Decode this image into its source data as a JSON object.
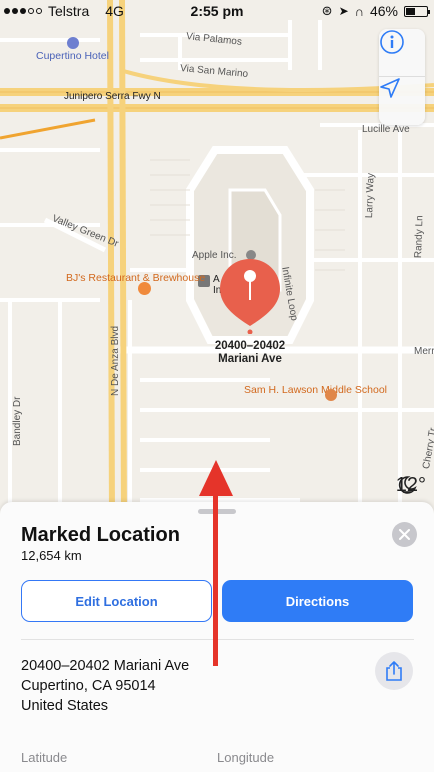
{
  "status_bar": {
    "carrier": "Telstra",
    "network": "4G",
    "time": "2:55 pm",
    "battery": "46%",
    "battery_level": 0.46
  },
  "map": {
    "labels": {
      "hotel": "Cupertino Hotel",
      "via_palamos": "Via Palamos",
      "via_san_marino": "Via San Marino",
      "junipero": "Junipero Serra Fwy N",
      "lucille": "Lucille Ave",
      "valley_green": "Valley Green Dr",
      "apple_inc": "Apple Inc.",
      "apple_inc_partial": "A",
      "apple_inc_partial2": "Inc",
      "restaurant": "BJ's Restaurant & Brewhouse",
      "infinite_loop": "Infinite Loop",
      "larry_way": "Larry Way",
      "randy_ln": "Randy Ln",
      "de_anza": "N De Anza Blvd",
      "merr": "Merr",
      "school": "Sam H. Lawson Middle School",
      "bandley": "Bandley Dr",
      "cherry": "Cherry Tr"
    },
    "pin_label_line1": "20400–20402",
    "pin_label_line2": "Mariani Ave",
    "weather": "12°",
    "icons": {
      "info": "info-icon",
      "locate": "location-arrow-icon",
      "pin": "map-pin-icon",
      "weather": "moon-cloud-icon"
    }
  },
  "sheet": {
    "title": "Marked Location",
    "distance": "12,654 km",
    "edit_label": "Edit Location",
    "directions_label": "Directions",
    "address_line1": "20400–20402 Mariani Ave",
    "address_line2": "Cupertino, CA  95014",
    "address_line3": "United States",
    "latitude_label": "Latitude",
    "longitude_label": "Longitude"
  },
  "colors": {
    "pin": "#e8604c",
    "accent": "#2f7cf6",
    "arrow": "#e5342a",
    "freeway": "#f6d27c"
  }
}
